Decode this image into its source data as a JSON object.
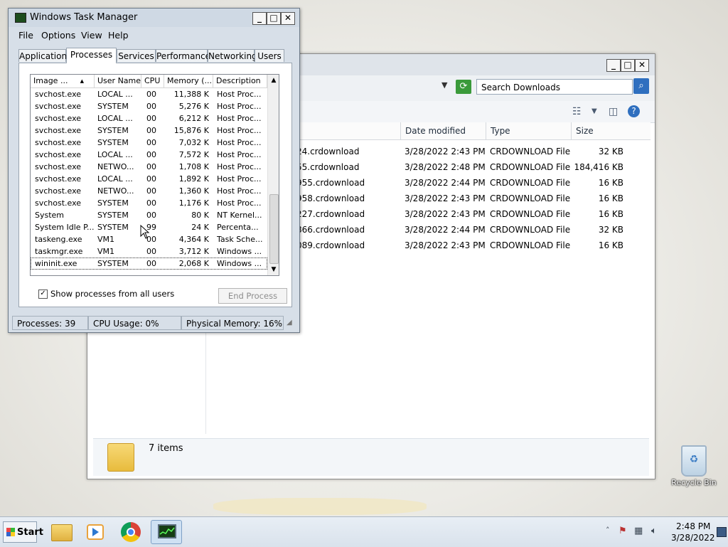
{
  "desktop": {
    "recycle_bin_label": "Recycle Bin"
  },
  "explorer": {
    "search_placeholder": "Search Downloads",
    "columns": [
      "Date modified",
      "Type",
      "Size"
    ],
    "files": [
      {
        "name": "24.crdownload",
        "date": "3/28/2022 2:43 PM",
        "type": "CRDOWNLOAD File",
        "size": "32 KB"
      },
      {
        "name": "55.crdownload",
        "date": "3/28/2022 2:48 PM",
        "type": "CRDOWNLOAD File",
        "size": "184,416 KB"
      },
      {
        "name": "955.crdownload",
        "date": "3/28/2022 2:44 PM",
        "type": "CRDOWNLOAD File",
        "size": "16 KB"
      },
      {
        "name": "958.crdownload",
        "date": "3/28/2022 2:43 PM",
        "type": "CRDOWNLOAD File",
        "size": "16 KB"
      },
      {
        "name": "227.crdownload",
        "date": "3/28/2022 2:43 PM",
        "type": "CRDOWNLOAD File",
        "size": "16 KB"
      },
      {
        "name": "866.crdownload",
        "date": "3/28/2022 2:44 PM",
        "type": "CRDOWNLOAD File",
        "size": "32 KB"
      },
      {
        "name": "089.crdownload",
        "date": "3/28/2022 2:43 PM",
        "type": "CRDOWNLOAD File",
        "size": "16 KB"
      }
    ],
    "details_text": "7 items"
  },
  "taskmgr": {
    "title": "Windows Task Manager",
    "menu": [
      "File",
      "Options",
      "View",
      "Help"
    ],
    "tabs": [
      "Applications",
      "Processes",
      "Services",
      "Performance",
      "Networking",
      "Users"
    ],
    "active_tab": "Processes",
    "columns": [
      "Image ...",
      "User Name",
      "CPU",
      "Memory (...",
      "Description"
    ],
    "processes": [
      {
        "image": "svchost.exe",
        "user": "LOCAL ...",
        "cpu": "00",
        "mem": "11,388 K",
        "desc": "Host Proc..."
      },
      {
        "image": "svchost.exe",
        "user": "SYSTEM",
        "cpu": "00",
        "mem": "5,276 K",
        "desc": "Host Proc..."
      },
      {
        "image": "svchost.exe",
        "user": "LOCAL ...",
        "cpu": "00",
        "mem": "6,212 K",
        "desc": "Host Proc..."
      },
      {
        "image": "svchost.exe",
        "user": "SYSTEM",
        "cpu": "00",
        "mem": "15,876 K",
        "desc": "Host Proc..."
      },
      {
        "image": "svchost.exe",
        "user": "SYSTEM",
        "cpu": "00",
        "mem": "7,032 K",
        "desc": "Host Proc..."
      },
      {
        "image": "svchost.exe",
        "user": "LOCAL ...",
        "cpu": "00",
        "mem": "7,572 K",
        "desc": "Host Proc..."
      },
      {
        "image": "svchost.exe",
        "user": "NETWO...",
        "cpu": "00",
        "mem": "1,708 K",
        "desc": "Host Proc..."
      },
      {
        "image": "svchost.exe",
        "user": "LOCAL ...",
        "cpu": "00",
        "mem": "1,892 K",
        "desc": "Host Proc..."
      },
      {
        "image": "svchost.exe",
        "user": "NETWO...",
        "cpu": "00",
        "mem": "1,360 K",
        "desc": "Host Proc..."
      },
      {
        "image": "svchost.exe",
        "user": "SYSTEM",
        "cpu": "00",
        "mem": "1,176 K",
        "desc": "Host Proc..."
      },
      {
        "image": "System",
        "user": "SYSTEM",
        "cpu": "00",
        "mem": "80 K",
        "desc": "NT Kernel..."
      },
      {
        "image": "System Idle P...",
        "user": "SYSTEM",
        "cpu": "99",
        "mem": "24 K",
        "desc": "Percenta..."
      },
      {
        "image": "taskeng.exe",
        "user": "VM1",
        "cpu": "00",
        "mem": "4,364 K",
        "desc": "Task Sche..."
      },
      {
        "image": "taskmgr.exe",
        "user": "VM1",
        "cpu": "00",
        "mem": "3,712 K",
        "desc": "Windows ..."
      },
      {
        "image": "wininit.exe",
        "user": "SYSTEM",
        "cpu": "00",
        "mem": "2,068 K",
        "desc": "Windows ..."
      }
    ],
    "show_all_label": "Show processes from all users",
    "show_all_checked": true,
    "end_process_label": "End Process",
    "status": {
      "processes": "Processes: 39",
      "cpu": "CPU Usage: 0%",
      "memory": "Physical Memory: 16%"
    }
  },
  "taskbar": {
    "start_label": "Start",
    "clock_time": "2:48 PM",
    "clock_date": "3/28/2022"
  },
  "colors": {
    "taskmgr_frame": "#d7dfe8",
    "explorer_titlebar": "#dfe4ea",
    "accent_blue": "#2f6fbf"
  }
}
